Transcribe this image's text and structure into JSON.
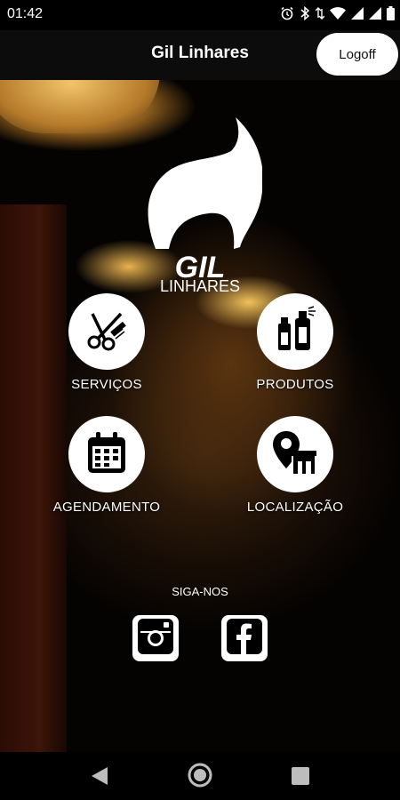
{
  "status_bar": {
    "time": "01:42",
    "icons": [
      "alarm-icon",
      "bluetooth-icon",
      "data-icon",
      "wifi-icon",
      "signal-icon",
      "signal-icon",
      "battery-icon"
    ]
  },
  "app_bar": {
    "title": "Gil Linhares",
    "logoff_label": "Logoff"
  },
  "logo": {
    "brand_top": "GIL",
    "brand_bottom": "LINHARES"
  },
  "menu": [
    {
      "label": "SERVIÇOS",
      "icon": "scissors-comb-icon"
    },
    {
      "label": "PRODUTOS",
      "icon": "spray-bottles-icon"
    },
    {
      "label": "AGENDAMENTO",
      "icon": "calendar-icon"
    },
    {
      "label": "LOCALIZAÇÃO",
      "icon": "location-store-icon"
    }
  ],
  "social": {
    "follow_label": "SIGA-NOS",
    "links": [
      {
        "name": "instagram",
        "icon": "instagram-icon"
      },
      {
        "name": "facebook",
        "icon": "facebook-icon"
      }
    ]
  },
  "nav_bar": {
    "buttons": [
      "back-icon",
      "home-icon",
      "recents-icon"
    ]
  },
  "colors": {
    "app_bar_bg": "#0c0c0c",
    "button_bg": "#ffffff",
    "text": "#ffffff"
  }
}
